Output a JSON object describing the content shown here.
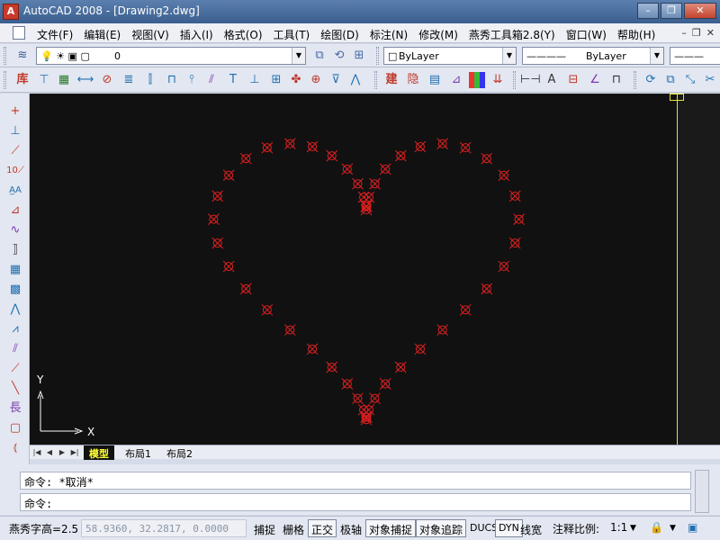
{
  "window": {
    "title": "AutoCAD 2008 - [Drawing2.dwg]",
    "app_icon": "A"
  },
  "menu": {
    "items": [
      "文件(F)",
      "编辑(E)",
      "视图(V)",
      "插入(I)",
      "格式(O)",
      "工具(T)",
      "绘图(D)",
      "标注(N)",
      "修改(M)",
      "燕秀工具箱2.8(Y)",
      "窗口(W)",
      "帮助(H)"
    ]
  },
  "toolbar": {
    "layer_value": "0",
    "color_value": "ByLayer",
    "linetype_value": "ByLayer",
    "lineweight_value": "",
    "row2_first_label": "库"
  },
  "canvas": {
    "axis_x": "X",
    "axis_y": "Y",
    "point_color": "#e02020",
    "background": "#111111",
    "point_count": 48
  },
  "tabs": {
    "items": [
      "模型",
      "布局1",
      "布局2"
    ],
    "active": "模型"
  },
  "command": {
    "history": "命令: *取消*",
    "prompt": "命令:"
  },
  "status": {
    "text_height": "燕秀字高=2.5",
    "coordinates": "58.9360, 32.2817, 0.0000",
    "buttons": [
      "捕捉",
      "栅格",
      "正交",
      "极轴",
      "对象捕捉",
      "对象追踪",
      "DUCS",
      "DYN",
      "线宽"
    ],
    "annotation_scale_label": "注释比例:",
    "annotation_scale_value": "1:1"
  }
}
